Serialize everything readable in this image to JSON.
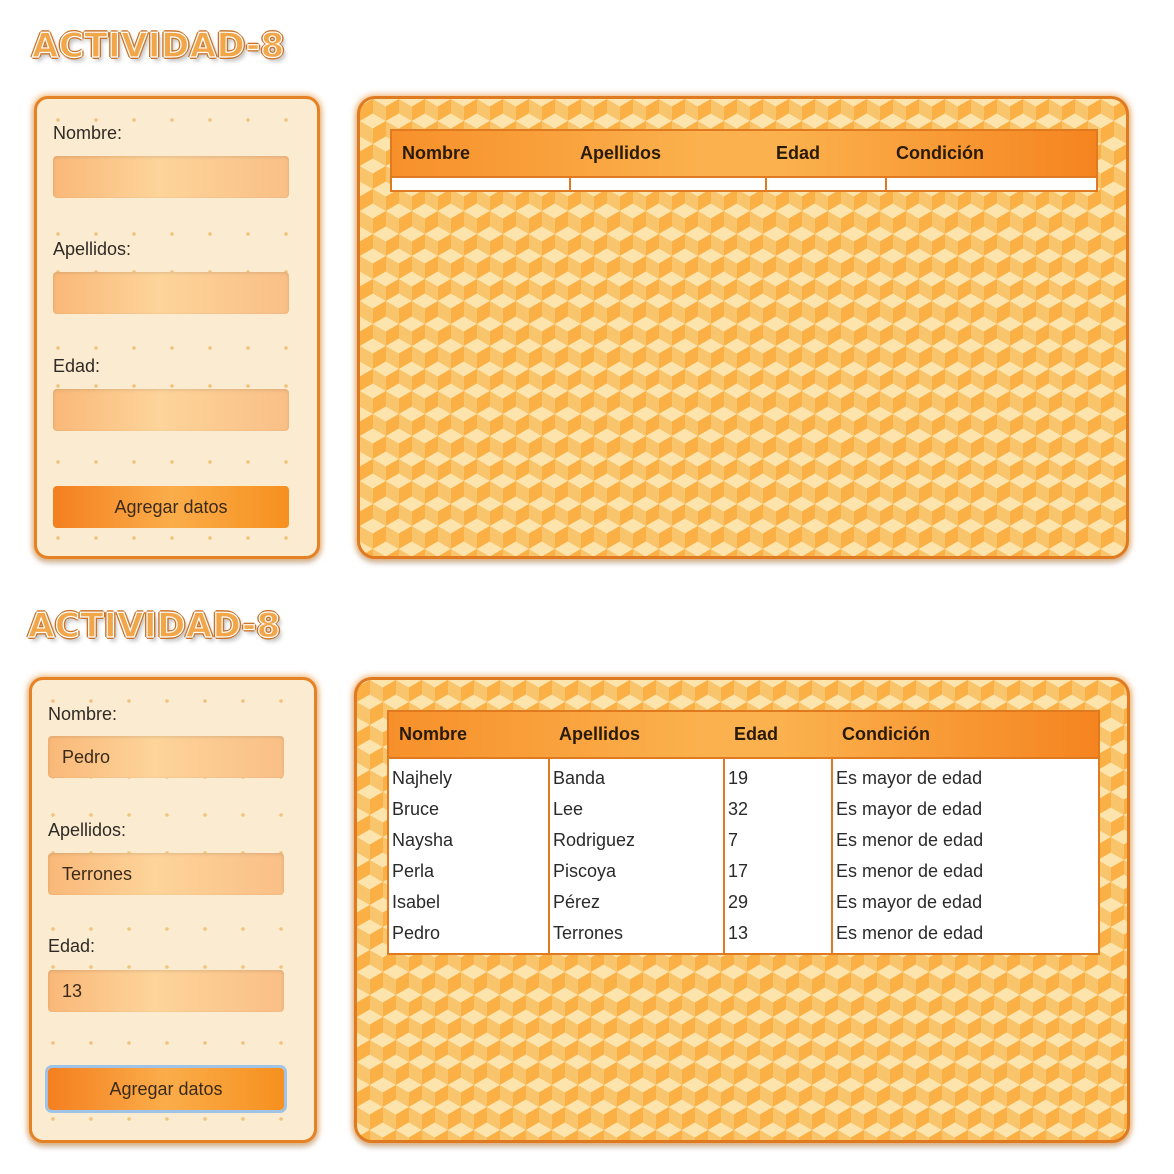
{
  "title": "ACTIVIDAD-8",
  "form": {
    "nombre_label": "Nombre:",
    "apellidos_label": "Apellidos:",
    "edad_label": "Edad:",
    "submit_label": "Agregar datos"
  },
  "table": {
    "headers": [
      "Nombre",
      "Apellidos",
      "Edad",
      "Condición"
    ]
  },
  "panel_empty": {
    "nombre_value": "",
    "apellidos_value": "",
    "edad_value": "",
    "rows": []
  },
  "panel_filled": {
    "nombre_value": "Pedro",
    "apellidos_value": "Terrones",
    "edad_value": "13",
    "rows": [
      [
        "Najhely",
        "Banda",
        "19",
        "Es mayor de edad"
      ],
      [
        "Bruce",
        "Lee",
        "32",
        "Es mayor de edad"
      ],
      [
        "Naysha",
        "Rodriguez",
        "7",
        "Es menor de edad"
      ],
      [
        "Perla",
        "Piscoya",
        "17",
        "Es menor de edad"
      ],
      [
        "Isabel",
        "Pérez",
        "29",
        "Es mayor de edad"
      ],
      [
        "Pedro",
        "Terrones",
        "13",
        "Es menor de edad"
      ]
    ]
  },
  "colors": {
    "accent": "#e58225",
    "form_bg": "#fbecd1",
    "focus_ring": "#9fc3e6"
  }
}
